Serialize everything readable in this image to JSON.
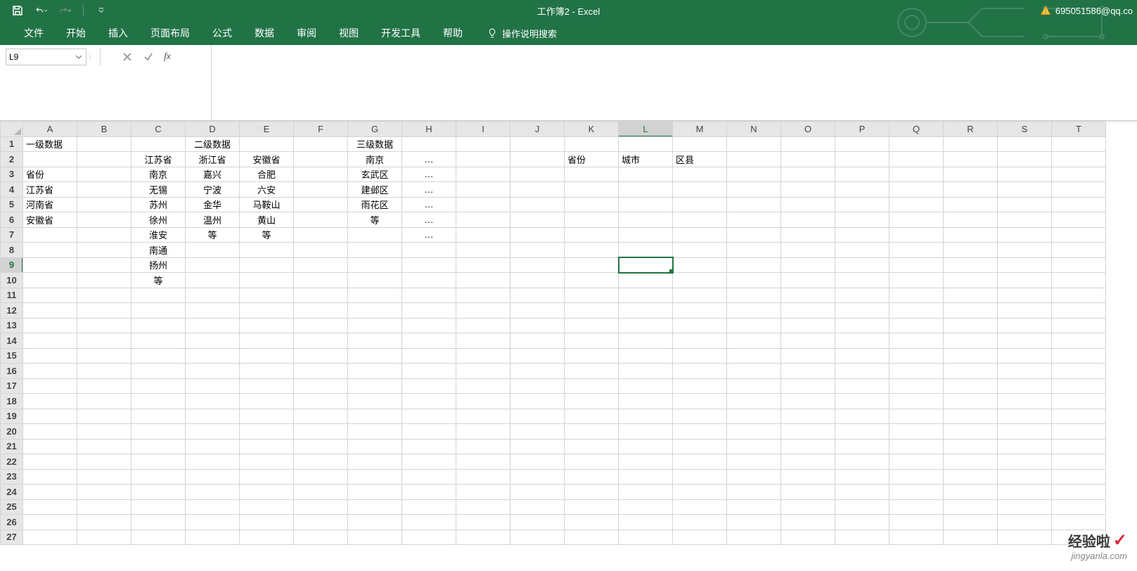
{
  "title": "工作簿2 - Excel",
  "account": "695051586@qq.co",
  "tabs": [
    "文件",
    "开始",
    "插入",
    "页面布局",
    "公式",
    "数据",
    "审阅",
    "视图",
    "开发工具",
    "帮助"
  ],
  "tellme": "操作说明搜索",
  "namebox": "L9",
  "columns": [
    "A",
    "B",
    "C",
    "D",
    "E",
    "F",
    "G",
    "H",
    "I",
    "J",
    "K",
    "L",
    "M",
    "N",
    "O",
    "P",
    "Q",
    "R",
    "S",
    "T"
  ],
  "rows": [
    "1",
    "2",
    "3",
    "4",
    "5",
    "6",
    "7",
    "8",
    "9",
    "10",
    "11",
    "12",
    "13",
    "14",
    "15",
    "16",
    "17",
    "18",
    "19",
    "20",
    "21",
    "22",
    "23",
    "24",
    "25",
    "26",
    "27"
  ],
  "cells": {
    "A1": "一级数据",
    "D1": "二级数据",
    "G1": "三级数据",
    "C2": "江苏省",
    "D2": "浙江省",
    "E2": "安徽省",
    "G2": "南京",
    "H2": "…",
    "K2": "省份",
    "L2": "城市",
    "M2": "区县",
    "A3": "省份",
    "C3": "南京",
    "D3": "嘉兴",
    "E3": "合肥",
    "G3": "玄武区",
    "H3": "…",
    "A4": "江苏省",
    "C4": "无锡",
    "D4": "宁波",
    "E4": "六安",
    "G4": "建邺区",
    "H4": "…",
    "A5": "河南省",
    "C5": "苏州",
    "D5": "金华",
    "E5": "马鞍山",
    "G5": "雨花区",
    "H5": "…",
    "A6": "安徽省",
    "C6": "徐州",
    "D6": "温州",
    "E6": "黄山",
    "G6": "等",
    "H6": "…",
    "C7": "淮安",
    "D7": "等",
    "E7": "等",
    "H7": "…",
    "C8": "南通",
    "C9": "扬州",
    "C10": "等"
  },
  "centered": [
    "C",
    "D",
    "E",
    "G",
    "H"
  ],
  "activeCell": "L9",
  "watermark": {
    "line1": "经验啦",
    "line2": "jingyanla.com"
  }
}
